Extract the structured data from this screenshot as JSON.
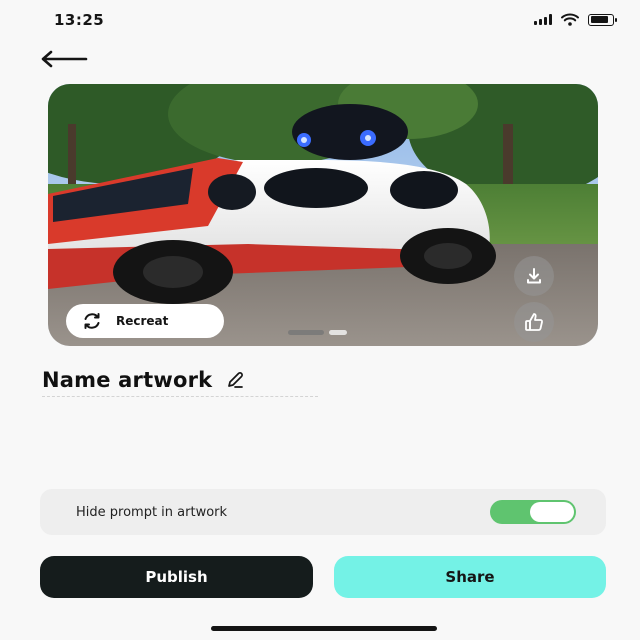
{
  "status_bar": {
    "time": "13:25",
    "icons": [
      "signal-icon",
      "wifi-icon",
      "battery-icon"
    ]
  },
  "navigation": {
    "back_icon": "arrow-left-icon"
  },
  "artwork": {
    "image_subject": "white and red robotic car in a park",
    "recreate_label": "Recreat",
    "recreate_icon": "refresh-icon",
    "download_icon": "download-icon",
    "like_icon": "thumbs-up-icon",
    "carousel": {
      "count": 2,
      "active": 1
    }
  },
  "name": {
    "title": "Name artwork",
    "edit_icon": "pencil-icon"
  },
  "settings": {
    "hide_prompt_label": "Hide prompt in artwork",
    "hide_prompt_enabled": true
  },
  "actions": {
    "publish_label": "Publish",
    "share_label": "Share"
  },
  "colors": {
    "publish_bg": "#151c1c",
    "share_bg": "#74f2e6",
    "toggle_on": "#5fc46f"
  }
}
